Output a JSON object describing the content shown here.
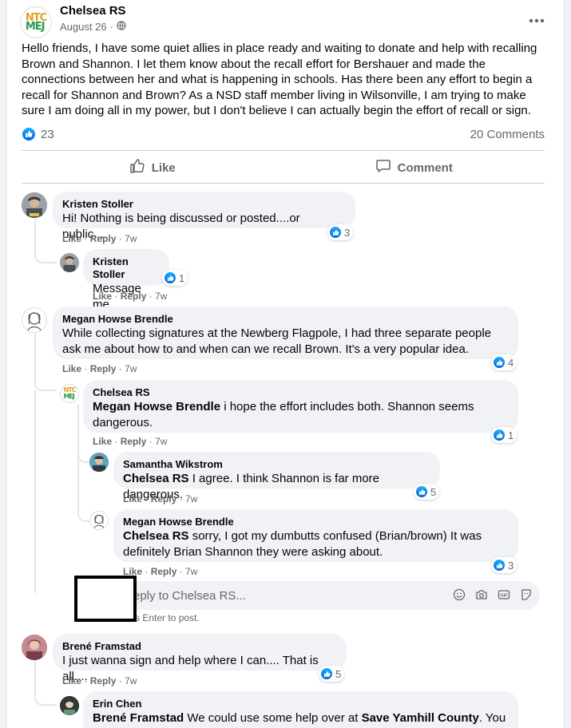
{
  "post": {
    "author": "Chelsea RS",
    "date": "August 26",
    "separator": "·",
    "logo_line1": "NTC",
    "logo_line2": "MEJ",
    "body": "Hello friends, I have some quiet allies in place ready and waiting to donate and help with recalling Brown and Shannon. I let them know about the recall effort for Bershauer and made the connections between her and what is happening in schools. Has there been any effort to begin a recall for Shannon and Brown? As a NSD staff member living in Wilsonville, I am trying to make sure I am doing all in my power, but I don't believe I can actually begin the effort of recall or sign.",
    "reaction_count": "23",
    "comments_count": "20 Comments",
    "like_label": "Like",
    "comment_label": "Comment"
  },
  "comments": [
    {
      "author": "Kristen Stoller",
      "text": "Hi! Nothing is being discussed or posted....or public....",
      "like": "Like",
      "reply": "Reply",
      "time": "7w",
      "reactions": "3"
    },
    {
      "author": "Kristen Stoller",
      "text": "Message me",
      "like": "Like",
      "reply": "Reply",
      "time": "7w",
      "reactions": "1"
    },
    {
      "author": "Megan Howse Brendle",
      "text": "While collecting signatures at the Newberg Flagpole, I had three separate people ask me about how to and when can we recall Brown. It's a very popular idea.",
      "like": "Like",
      "reply": "Reply",
      "time": "7w",
      "reactions": "4"
    },
    {
      "author": "Chelsea RS",
      "mention": "Megan Howse Brendle",
      "text": " i hope the effort includes both. Shannon seems dangerous.",
      "like": "Like",
      "reply": "Reply",
      "time": "7w",
      "reactions": "1"
    },
    {
      "author": "Samantha Wikstrom",
      "mention": "Chelsea RS",
      "text": " I agree. I think Shannon is far more dangerous.",
      "like": "Like",
      "reply": "Reply",
      "time": "7w",
      "reactions": "5"
    },
    {
      "author": "Megan Howse Brendle",
      "mention": "Chelsea RS",
      "text": " sorry, I got my dumbutts confused (Brian/brown) It was definitely Brian Shannon they were asking about.",
      "like": "Like",
      "reply": "Reply",
      "time": "7w",
      "reactions": "3"
    },
    {
      "author": "Brené Framstad",
      "text": "I just wanna sign and help where I can.... That is all....",
      "like": "Like",
      "reply": "Reply",
      "time": "7w",
      "reactions": "5"
    },
    {
      "author": "Erin Chen",
      "mention": "Brené Framstad",
      "text": " We could use some help over at ",
      "mention2": "Save Yamhill County",
      "text2": ". You"
    }
  ],
  "reply_box": {
    "placeholder": "eply to Chelsea RS...",
    "hint": "s Enter to post."
  },
  "colors": {
    "accent": "#1877f2",
    "bubble": "#f0f2f5",
    "muted": "#65676b"
  }
}
